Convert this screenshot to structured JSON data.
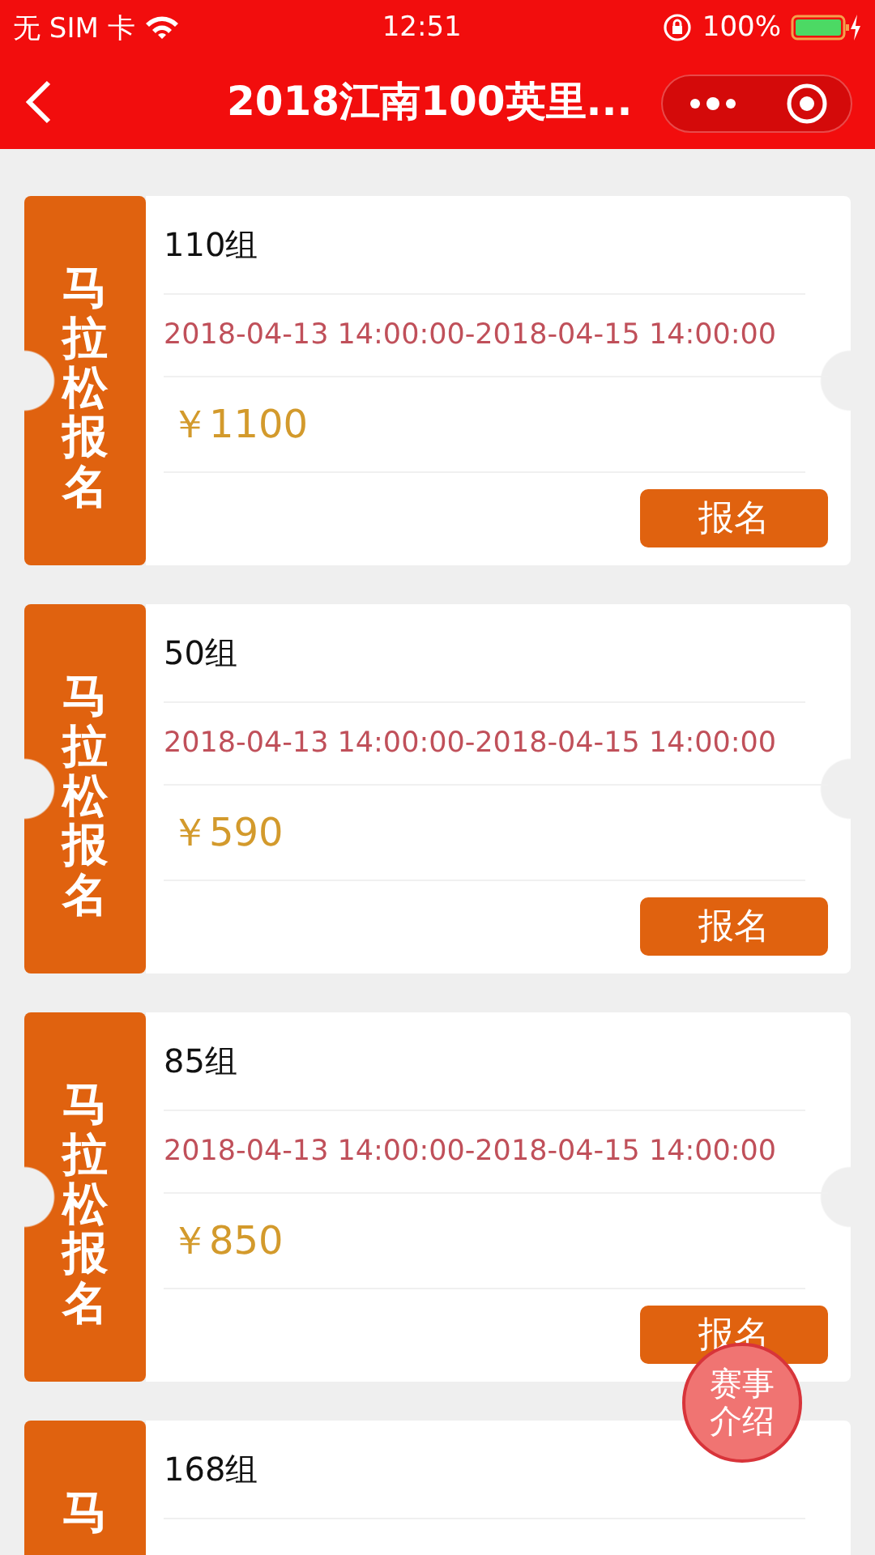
{
  "status_bar": {
    "carrier": "无 SIM 卡",
    "time": "12:51",
    "battery": "100%"
  },
  "nav_bar": {
    "title": "2018江南100英里..."
  },
  "tickets": [
    {
      "stub": "马拉松报名",
      "name": "110组",
      "period": "2018-04-13 14:00:00-2018-04-15 14:00:00",
      "price": "￥1100",
      "button": "报名"
    },
    {
      "stub": "马拉松报名",
      "name": "50组",
      "period": "2018-04-13 14:00:00-2018-04-15 14:00:00",
      "price": "￥590",
      "button": "报名"
    },
    {
      "stub": "马拉松报名",
      "name": "85组",
      "period": "2018-04-13 14:00:00-2018-04-15 14:00:00",
      "price": "￥850",
      "button": "报名"
    },
    {
      "stub": "马",
      "name": "168组"
    }
  ],
  "float_button": "赛事介绍"
}
